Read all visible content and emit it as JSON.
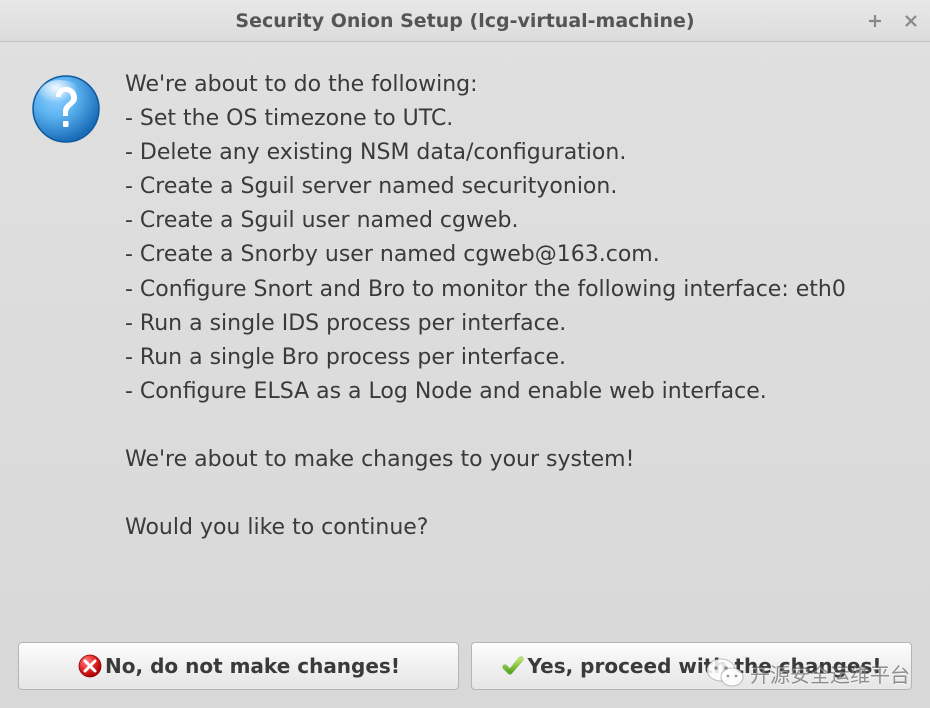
{
  "window": {
    "title": "Security Onion Setup (lcg-virtual-machine)"
  },
  "message": {
    "intro": "We're about to do the following:",
    "items": [
      "- Set the OS timezone to UTC.",
      "- Delete any existing NSM data/configuration.",
      "- Create a Sguil server named securityonion.",
      "- Create a Sguil user named cgweb.",
      "- Create a Snorby user named cgweb@163.com.",
      "- Configure Snort and Bro to monitor the following interface: eth0",
      "- Run a single IDS process per interface.",
      "- Run a single Bro process per interface.",
      "- Configure ELSA as a Log Node and enable web interface."
    ],
    "warning": "We're about to make changes to your system!",
    "prompt": "Would you like to continue?"
  },
  "buttons": {
    "no_label": "No, do not make changes!",
    "yes_label": "Yes, proceed with the changes!"
  },
  "watermark": {
    "text": "开源安全运维平台"
  }
}
